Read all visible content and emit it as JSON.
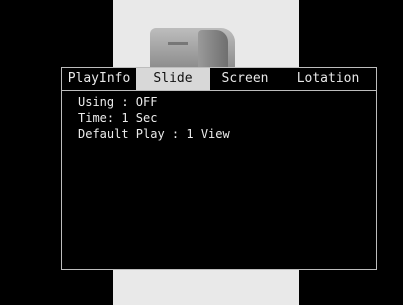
{
  "tabs": [
    {
      "label": "PlayInfo"
    },
    {
      "label": "Slide"
    },
    {
      "label": "Screen"
    },
    {
      "label": "Lotation"
    }
  ],
  "active_tab": "Slide",
  "settings": [
    {
      "text": "Using : OFF"
    },
    {
      "text": "Time: 1 Sec"
    },
    {
      "text": "Default Play : 1 View"
    }
  ]
}
